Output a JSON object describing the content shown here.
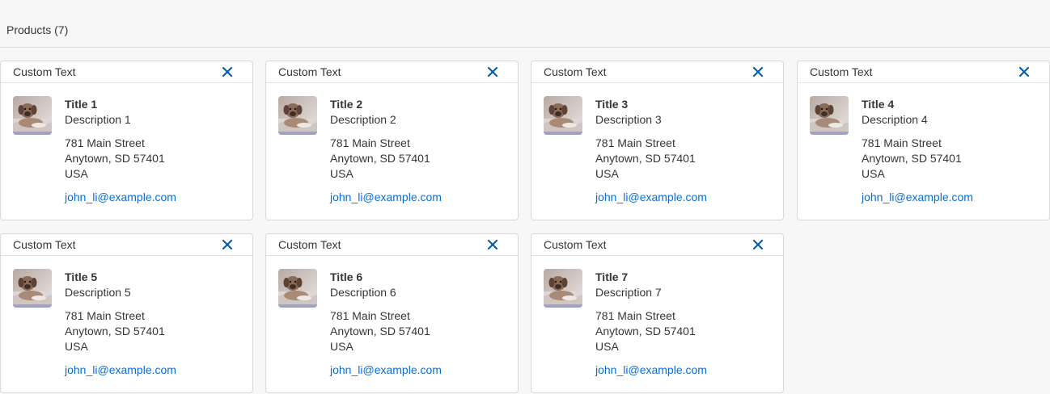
{
  "toolbar": {
    "title": "Products (7)"
  },
  "colors": {
    "link": "#0a6ed1",
    "close_icon": "#0a5ea8",
    "text": "#32363a",
    "background": "#f7f7f7"
  },
  "cards": [
    {
      "header": "Custom Text",
      "close_icon": "close-icon",
      "title": "Title 1",
      "description": "Description 1",
      "address_line1": "781 Main Street",
      "address_line2": "Anytown, SD 57401",
      "address_line3": "USA",
      "email": "john_li@example.com"
    },
    {
      "header": "Custom Text",
      "close_icon": "close-icon",
      "title": "Title 2",
      "description": "Description 2",
      "address_line1": "781 Main Street",
      "address_line2": "Anytown, SD 57401",
      "address_line3": "USA",
      "email": "john_li@example.com"
    },
    {
      "header": "Custom Text",
      "close_icon": "close-icon",
      "title": "Title 3",
      "description": "Description 3",
      "address_line1": "781 Main Street",
      "address_line2": "Anytown, SD 57401",
      "address_line3": "USA",
      "email": "john_li@example.com"
    },
    {
      "header": "Custom Text",
      "close_icon": "close-icon",
      "title": "Title 4",
      "description": "Description 4",
      "address_line1": "781 Main Street",
      "address_line2": "Anytown, SD 57401",
      "address_line3": "USA",
      "email": "john_li@example.com"
    },
    {
      "header": "Custom Text",
      "close_icon": "close-icon",
      "title": "Title 5",
      "description": "Description 5",
      "address_line1": "781 Main Street",
      "address_line2": "Anytown, SD 57401",
      "address_line3": "USA",
      "email": "john_li@example.com"
    },
    {
      "header": "Custom Text",
      "close_icon": "close-icon",
      "title": "Title 6",
      "description": "Description 6",
      "address_line1": "781 Main Street",
      "address_line2": "Anytown, SD 57401",
      "address_line3": "USA",
      "email": "john_li@example.com"
    },
    {
      "header": "Custom Text",
      "close_icon": "close-icon",
      "title": "Title 7",
      "description": "Description 7",
      "address_line1": "781 Main Street",
      "address_line2": "Anytown, SD 57401",
      "address_line3": "USA",
      "email": "john_li@example.com"
    }
  ]
}
